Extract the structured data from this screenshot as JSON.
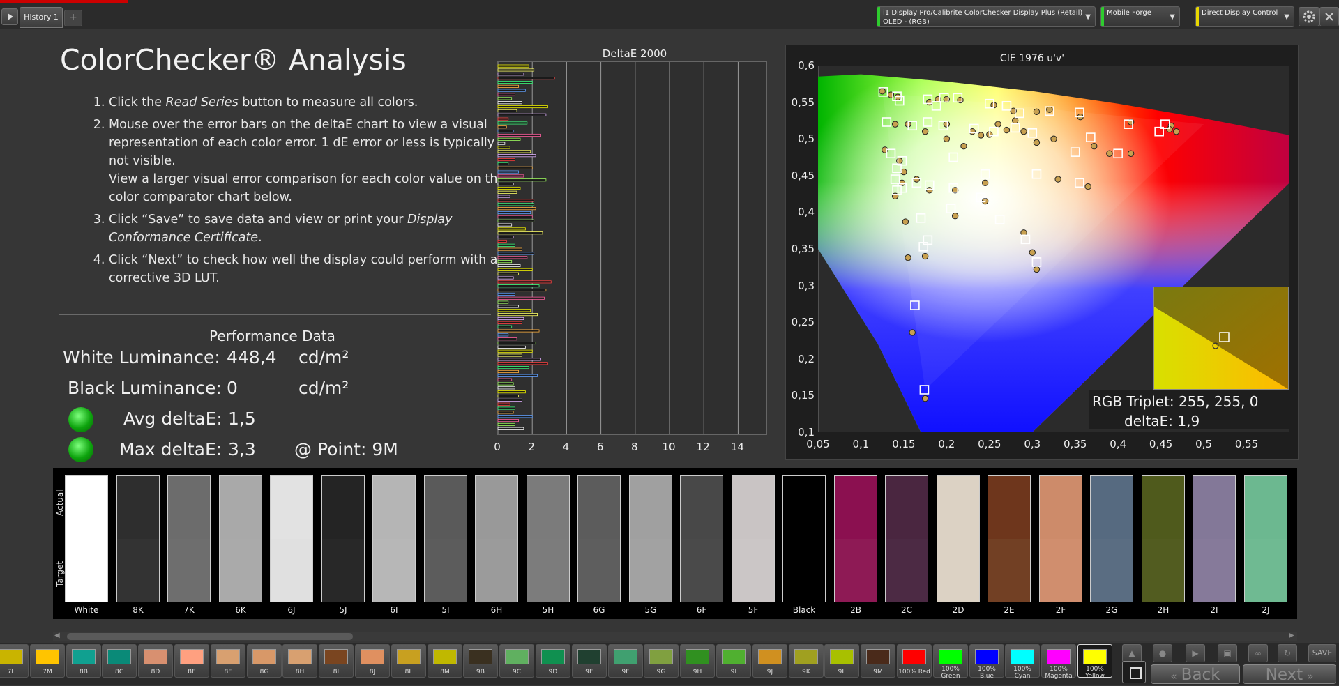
{
  "topbar": {
    "history_tab": "History 1",
    "add_tab": "+",
    "device_line1": "i1 Display Pro/Calibrite ColorChecker Display Plus (Retail)",
    "device_line2": "OLED - (RGB)",
    "pattern_generator": "Mobile Forge",
    "display_control": "Direct Display Control"
  },
  "left": {
    "title": "ColorChecker® Analysis",
    "step1_a": "Click the ",
    "step1_em": "Read Series",
    "step1_b": " button to measure all colors.",
    "step2_a": "Mouse over the error bars on the deltaE chart to view a visual representation of each color error. 1 dE error or less is typically not visible.",
    "step2_b": "View a larger visual error comparison for each color value on the color comparator chart below.",
    "step3_a": "Click “Save” to save data and view or print your ",
    "step3_em": "Display Conformance Certificate",
    "step3_b": ".",
    "step4": "Click “Next” to check how well the display could perform with a corrective 3D LUT."
  },
  "performance": {
    "heading": "Performance Data",
    "white_label": "White Luminance:",
    "white_value": "448,4",
    "white_unit": "cd/m²",
    "black_label": "Black Luminance:",
    "black_value": "0",
    "black_unit": "cd/m²",
    "avg_label": "Avg deltaE:",
    "avg_value": "1,5",
    "max_label": "Max deltaE:",
    "max_value": "3,3",
    "point_label": "@ Point: 9M"
  },
  "chart_data": [
    {
      "type": "bar",
      "title": "DeltaE 2000",
      "orientation": "horizontal",
      "xlim": [
        0,
        15
      ],
      "xticks": [
        "0",
        "2",
        "4",
        "6",
        "8",
        "10",
        "12",
        "14"
      ],
      "grid": true,
      "values": [
        1.8,
        2.1,
        1.5,
        3.3,
        2.0,
        1.2,
        1.6,
        1.0,
        0.8,
        1.4,
        2.9,
        1.1,
        2.8,
        0.6,
        1.7,
        0.5,
        0.9,
        2.5,
        1.3,
        0.4,
        0.7,
        1.9,
        2.2,
        1.0,
        0.6,
        2.0,
        1.2,
        1.5,
        2.8,
        0.9,
        1.3,
        1.1,
        0.7,
        2.1,
        2.1,
        2.2,
        1.9,
        2.0,
        2.1,
        0.8,
        1.6,
        2.6,
        0.9,
        0.5,
        1.0,
        1.4,
        2.1,
        1.7,
        0.8,
        1.3,
        2.0,
        1.2,
        0.9,
        3.1,
        2.4,
        2.8,
        1.0,
        2.7,
        0.6,
        1.2,
        1.9,
        2.3,
        1.5,
        1.4,
        0.8,
        2.4,
        0.6,
        1.1,
        2.2,
        1.6,
        2.0,
        1.4,
        2.5,
        2.9,
        1.8,
        1.2,
        2.3,
        0.8,
        0.9,
        1.0,
        1.6,
        1.2,
        1.4,
        0.7,
        1.0,
        0.9,
        2.0,
        1.2,
        1.0,
        1.5
      ],
      "colors": [
        "#f4f400",
        "#ffff66",
        "#e0b0ff",
        "#ff4040",
        "#40ff80",
        "#ffb040",
        "#60a0ff",
        "#ff60a0",
        "#a0ff60",
        "#ffffff"
      ]
    },
    {
      "type": "scatter",
      "title": "CIE 1976 u'v'",
      "xlim": [
        0.05,
        0.6
      ],
      "ylim": [
        0.1,
        0.6
      ],
      "xticks": [
        "0,05",
        "0,1",
        "0,15",
        "0,2",
        "0,25",
        "0,3",
        "0,35",
        "0,4",
        "0,45",
        "0,5",
        "0,55"
      ],
      "yticks": [
        "0,6",
        "0,55",
        "0,5",
        "0,45",
        "0,4",
        "0,35",
        "0,3",
        "0,25",
        "0,2",
        "0,15",
        "0,1"
      ],
      "targets": [
        [
          0.126,
          0.564
        ],
        [
          0.142,
          0.558
        ],
        [
          0.145,
          0.552
        ],
        [
          0.178,
          0.554
        ],
        [
          0.188,
          0.545
        ],
        [
          0.197,
          0.556
        ],
        [
          0.213,
          0.556
        ],
        [
          0.25,
          0.548
        ],
        [
          0.27,
          0.545
        ],
        [
          0.285,
          0.535
        ],
        [
          0.32,
          0.538
        ],
        [
          0.355,
          0.536
        ],
        [
          0.412,
          0.52
        ],
        [
          0.455,
          0.52
        ],
        [
          0.448,
          0.51
        ],
        [
          0.13,
          0.523
        ],
        [
          0.16,
          0.518
        ],
        [
          0.178,
          0.523
        ],
        [
          0.196,
          0.518
        ],
        [
          0.232,
          0.514
        ],
        [
          0.255,
          0.51
        ],
        [
          0.28,
          0.515
        ],
        [
          0.3,
          0.508
        ],
        [
          0.368,
          0.502
        ],
        [
          0.35,
          0.482
        ],
        [
          0.4,
          0.48
        ],
        [
          0.135,
          0.48
        ],
        [
          0.142,
          0.46
        ],
        [
          0.14,
          0.445
        ],
        [
          0.148,
          0.433
        ],
        [
          0.165,
          0.44
        ],
        [
          0.18,
          0.437
        ],
        [
          0.208,
          0.433
        ],
        [
          0.245,
          0.452
        ],
        [
          0.305,
          0.452
        ],
        [
          0.355,
          0.44
        ],
        [
          0.142,
          0.43
        ],
        [
          0.205,
          0.405
        ],
        [
          0.24,
          0.42
        ],
        [
          0.262,
          0.39
        ],
        [
          0.17,
          0.392
        ],
        [
          0.178,
          0.362
        ],
        [
          0.173,
          0.353
        ],
        [
          0.292,
          0.363
        ],
        [
          0.305,
          0.332
        ],
        [
          0.163,
          0.273
        ],
        [
          0.174,
          0.158
        ],
        [
          0.148,
          0.47
        ],
        [
          0.208,
          0.475
        ]
      ],
      "measured": [
        [
          0.125,
          0.565
        ],
        [
          0.135,
          0.56
        ],
        [
          0.143,
          0.557
        ],
        [
          0.18,
          0.55
        ],
        [
          0.19,
          0.554
        ],
        [
          0.2,
          0.554
        ],
        [
          0.216,
          0.553
        ],
        [
          0.255,
          0.546
        ],
        [
          0.278,
          0.538
        ],
        [
          0.305,
          0.537
        ],
        [
          0.32,
          0.54
        ],
        [
          0.356,
          0.53
        ],
        [
          0.415,
          0.523
        ],
        [
          0.462,
          0.518
        ],
        [
          0.46,
          0.513
        ],
        [
          0.468,
          0.51
        ],
        [
          0.14,
          0.52
        ],
        [
          0.155,
          0.52
        ],
        [
          0.175,
          0.51
        ],
        [
          0.2,
          0.52
        ],
        [
          0.23,
          0.51
        ],
        [
          0.25,
          0.506
        ],
        [
          0.27,
          0.512
        ],
        [
          0.29,
          0.51
        ],
        [
          0.305,
          0.495
        ],
        [
          0.325,
          0.5
        ],
        [
          0.372,
          0.49
        ],
        [
          0.39,
          0.48
        ],
        [
          0.415,
          0.48
        ],
        [
          0.128,
          0.485
        ],
        [
          0.145,
          0.47
        ],
        [
          0.148,
          0.44
        ],
        [
          0.15,
          0.455
        ],
        [
          0.165,
          0.445
        ],
        [
          0.18,
          0.43
        ],
        [
          0.21,
          0.43
        ],
        [
          0.245,
          0.44
        ],
        [
          0.33,
          0.445
        ],
        [
          0.365,
          0.435
        ],
        [
          0.14,
          0.422
        ],
        [
          0.21,
          0.395
        ],
        [
          0.245,
          0.415
        ],
        [
          0.29,
          0.372
        ],
        [
          0.152,
          0.387
        ],
        [
          0.175,
          0.34
        ],
        [
          0.155,
          0.338
        ],
        [
          0.3,
          0.345
        ],
        [
          0.305,
          0.322
        ],
        [
          0.16,
          0.236
        ],
        [
          0.175,
          0.146
        ],
        [
          0.2,
          0.5
        ],
        [
          0.22,
          0.49
        ],
        [
          0.24,
          0.505
        ],
        [
          0.26,
          0.52
        ],
        [
          0.28,
          0.525
        ]
      ],
      "inset_text_1": "RGB Triplet: 255, 255, 0",
      "inset_text_2": "deltaE: 1,9"
    }
  ],
  "swatches": {
    "actual_label": "Actual",
    "target_label": "Target",
    "items": [
      {
        "label": "White",
        "actual": "#ffffff",
        "target": "#ffffff"
      },
      {
        "label": "8K",
        "actual": "#2e2e2e",
        "target": "#333333"
      },
      {
        "label": "7K",
        "actual": "#6c6c6c",
        "target": "#6e6e6e"
      },
      {
        "label": "6K",
        "actual": "#a9a9a9",
        "target": "#aaaaaa"
      },
      {
        "label": "6J",
        "actual": "#e2e2e2",
        "target": "#e0e0e0"
      },
      {
        "label": "5J",
        "actual": "#242424",
        "target": "#282828"
      },
      {
        "label": "6I",
        "actual": "#b5b5b5",
        "target": "#b7b7b7"
      },
      {
        "label": "5I",
        "actual": "#5a5a5a",
        "target": "#5c5c5c"
      },
      {
        "label": "6H",
        "actual": "#999999",
        "target": "#9b9b9b"
      },
      {
        "label": "5H",
        "actual": "#7b7b7b",
        "target": "#7c7c7c"
      },
      {
        "label": "6G",
        "actual": "#5c5c5c",
        "target": "#5e5e5e"
      },
      {
        "label": "5G",
        "actual": "#a0a0a0",
        "target": "#a2a2a2"
      },
      {
        "label": "6F",
        "actual": "#484848",
        "target": "#4a4a4a"
      },
      {
        "label": "5F",
        "actual": "#c9c4c4",
        "target": "#cbc6c6"
      },
      {
        "label": "Black",
        "actual": "#000000",
        "target": "#000000"
      },
      {
        "label": "2B",
        "actual": "#8b1050",
        "target": "#8e1a55"
      },
      {
        "label": "2C",
        "actual": "#4a2640",
        "target": "#4c2a44"
      },
      {
        "label": "2D",
        "actual": "#dcd2c4",
        "target": "#dcd2c4"
      },
      {
        "label": "2E",
        "actual": "#6e361c",
        "target": "#724024"
      },
      {
        "label": "2F",
        "actual": "#cd8b6a",
        "target": "#d08e6e"
      },
      {
        "label": "2G",
        "actual": "#566a80",
        "target": "#5a6d82"
      },
      {
        "label": "2H",
        "actual": "#4f5a1c",
        "target": "#525c20"
      },
      {
        "label": "2I",
        "actual": "#837898",
        "target": "#867a9a"
      },
      {
        "label": "2J",
        "actual": "#6cb890",
        "target": "#6fba92"
      }
    ]
  },
  "bottom": {
    "items": [
      {
        "label": "7L",
        "color": "#c9b400"
      },
      {
        "label": "7M",
        "color": "#ffc400"
      },
      {
        "label": "8B",
        "color": "#10a090"
      },
      {
        "label": "8C",
        "color": "#0a8a78"
      },
      {
        "label": "8D",
        "color": "#d89070"
      },
      {
        "label": "8E",
        "color": "#ffa080"
      },
      {
        "label": "8F",
        "color": "#d8a070"
      },
      {
        "label": "8G",
        "color": "#d89868"
      },
      {
        "label": "8H",
        "color": "#d8a070"
      },
      {
        "label": "8I",
        "color": "#7a4520"
      },
      {
        "label": "8J",
        "color": "#e09060"
      },
      {
        "label": "8L",
        "color": "#c8a020"
      },
      {
        "label": "8M",
        "color": "#c0b800"
      },
      {
        "label": "9B",
        "color": "#3a3020"
      },
      {
        "label": "9C",
        "color": "#60b060"
      },
      {
        "label": "9D",
        "color": "#109050"
      },
      {
        "label": "9E",
        "color": "#204030"
      },
      {
        "label": "9F",
        "color": "#40a070"
      },
      {
        "label": "9G",
        "color": "#80a040"
      },
      {
        "label": "9H",
        "color": "#309020"
      },
      {
        "label": "9I",
        "color": "#50b030"
      },
      {
        "label": "9J",
        "color": "#d09020"
      },
      {
        "label": "9K",
        "color": "#a0a020"
      },
      {
        "label": "9L",
        "color": "#a8c000"
      },
      {
        "label": "9M",
        "color": "#4a2a1a"
      },
      {
        "label": "100% Red",
        "color": "#ff0000"
      },
      {
        "label": "100% Green",
        "color": "#00ff00"
      },
      {
        "label": "100% Blue",
        "color": "#0000ff"
      },
      {
        "label": "100% Cyan",
        "color": "#00ffff"
      },
      {
        "label": "100% Magenta",
        "color": "#ff00ff"
      },
      {
        "label": "100% Yellow",
        "color": "#ffff00"
      }
    ],
    "save": "SAVE",
    "back": "Back",
    "next": "Next"
  }
}
